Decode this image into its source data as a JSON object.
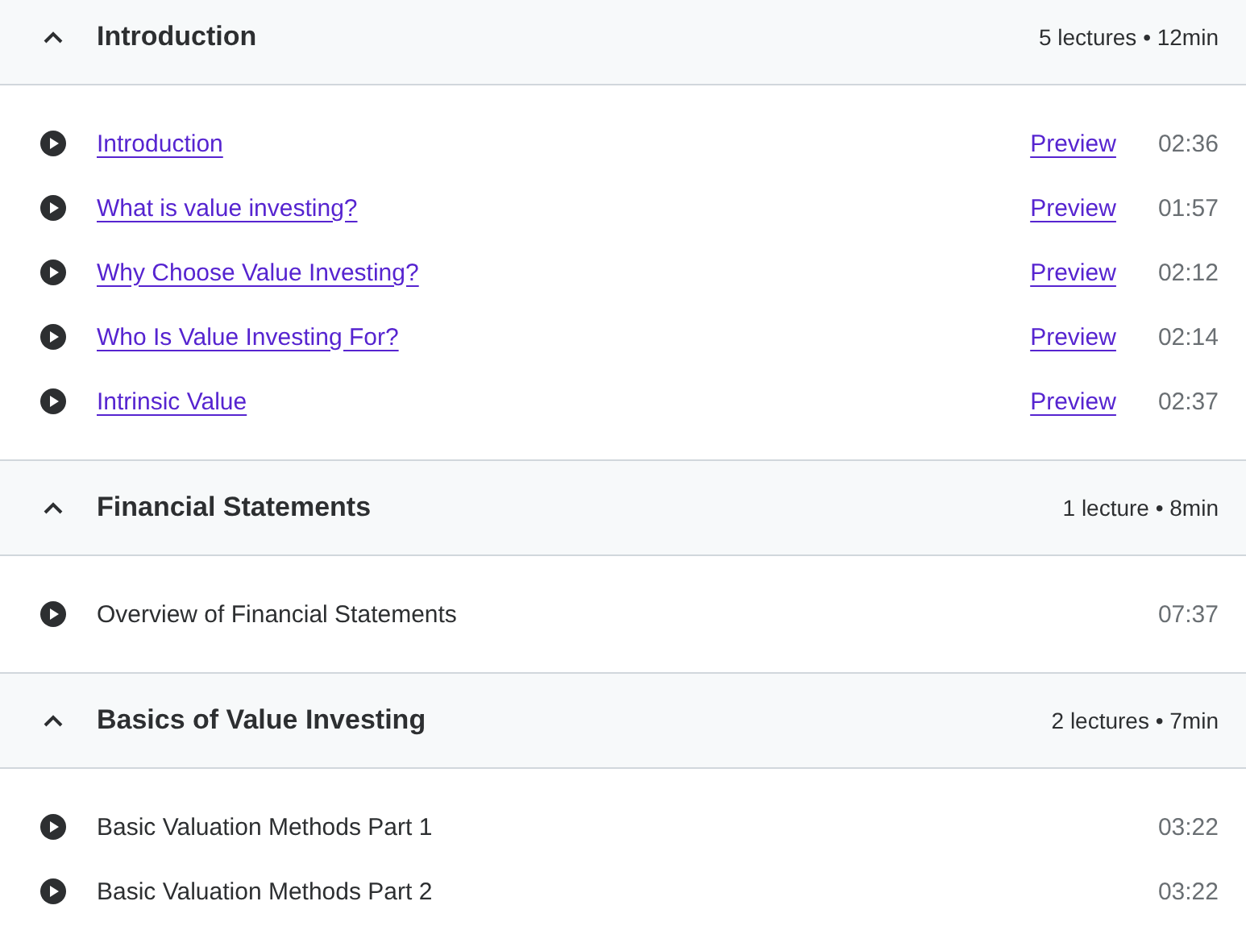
{
  "sections": [
    {
      "title": "Introduction",
      "summary": "5 lectures • 12min",
      "expanded": true,
      "lectures": [
        {
          "kind": "link",
          "title": "Introduction",
          "preview": "Preview",
          "duration": "02:36"
        },
        {
          "kind": "link",
          "title": "What is value investing?",
          "preview": "Preview",
          "duration": "01:57"
        },
        {
          "kind": "link",
          "title": "Why Choose Value Investing?",
          "preview": "Preview",
          "duration": "02:12"
        },
        {
          "kind": "link",
          "title": "Who Is Value Investing For?",
          "preview": "Preview",
          "duration": "02:14"
        },
        {
          "kind": "link",
          "title": "Intrinsic Value",
          "preview": "Preview",
          "duration": "02:37"
        }
      ]
    },
    {
      "title": "Financial Statements",
      "summary": "1 lecture • 8min",
      "expanded": true,
      "lectures": [
        {
          "kind": "plain",
          "title": "Overview of Financial Statements",
          "duration": "07:37"
        }
      ]
    },
    {
      "title": "Basics of Value Investing",
      "summary": "2 lectures • 7min",
      "expanded": true,
      "lectures": [
        {
          "kind": "plain",
          "title": "Basic Valuation Methods Part 1",
          "duration": "03:22"
        },
        {
          "kind": "plain",
          "title": "Basic Valuation Methods Part 2",
          "duration": "03:22"
        }
      ]
    }
  ]
}
